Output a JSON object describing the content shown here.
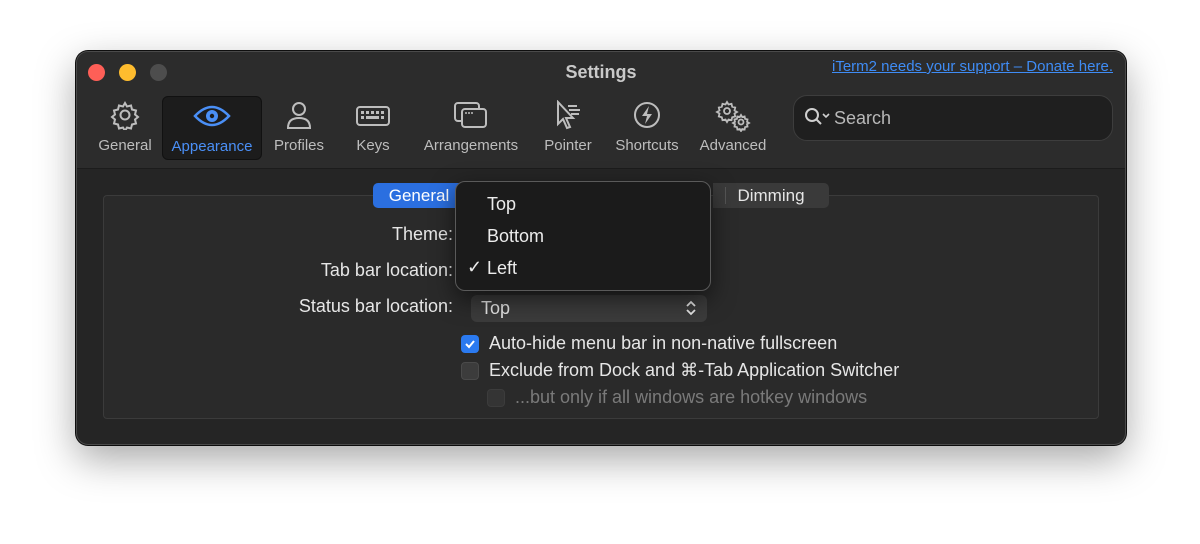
{
  "window": {
    "title": "Settings",
    "donate_link": "iTerm2 needs your support – Donate here."
  },
  "toolbar": {
    "items": [
      {
        "label": "General",
        "icon": "gear-icon"
      },
      {
        "label": "Appearance",
        "icon": "eye-icon",
        "selected": true
      },
      {
        "label": "Profiles",
        "icon": "person-icon"
      },
      {
        "label": "Keys",
        "icon": "keyboard-icon"
      },
      {
        "label": "Arrangements",
        "icon": "windows-icon"
      },
      {
        "label": "Pointer",
        "icon": "pointer-icon"
      },
      {
        "label": "Shortcuts",
        "icon": "bolt-icon"
      },
      {
        "label": "Advanced",
        "icon": "gears-icon"
      }
    ],
    "search_placeholder": "Search"
  },
  "tabs": {
    "general": "General",
    "dimming": "Dimming"
  },
  "form": {
    "theme_label": "Theme:",
    "tab_bar_label": "Tab bar location:",
    "status_bar_label": "Status bar location:",
    "status_bar_value": "Top",
    "checkboxes": [
      {
        "label": "Auto-hide menu bar in non-native fullscreen",
        "checked": true
      },
      {
        "label": "Exclude from Dock and ⌘-Tab Application Switcher",
        "checked": false
      },
      {
        "label": "...but only if all windows are hotkey windows",
        "checked": false,
        "disabled": true
      }
    ]
  },
  "dropdown_menu": {
    "options": [
      "Top",
      "Bottom",
      "Left"
    ],
    "selected": "Left",
    "check_mark": "✓"
  },
  "colors": {
    "accent": "#2b6fe0",
    "link": "#3f8cf5",
    "window_bg": "#252525"
  }
}
